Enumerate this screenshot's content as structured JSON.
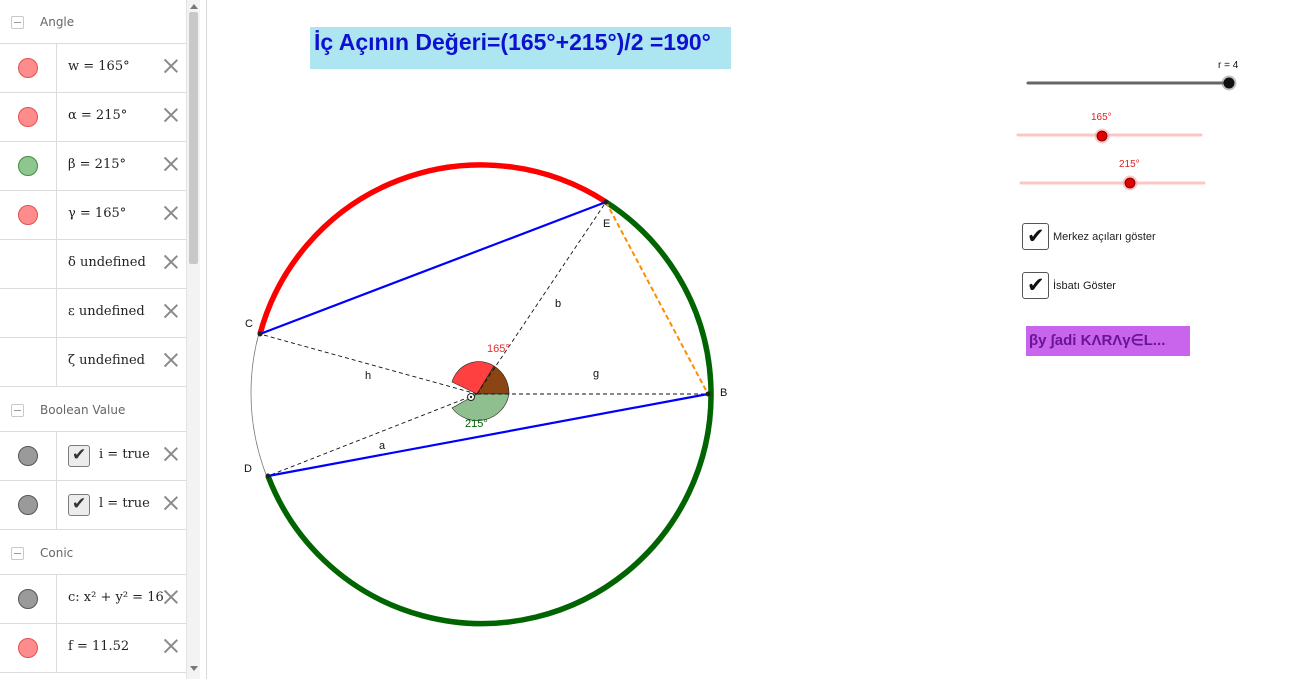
{
  "algebra": {
    "groups": {
      "angle": "Angle",
      "boolean": "Boolean Value",
      "conic": "Conic"
    },
    "angle_rows": [
      {
        "expr": "w = 165°",
        "marble_color": "#ff8080",
        "has_marble": true
      },
      {
        "expr": "α = 215°",
        "marble_color": "#ff8080",
        "has_marble": true
      },
      {
        "expr": "β = 215°",
        "marble_color": "#8fc58f",
        "has_marble": true
      },
      {
        "expr": "γ = 165°",
        "marble_color": "#ff8080",
        "has_marble": true
      },
      {
        "expr": "δ undefined",
        "has_marble": false
      },
      {
        "expr": "ε undefined",
        "has_marble": false
      },
      {
        "expr": "ζ undefined",
        "has_marble": false
      }
    ],
    "boolean_rows": [
      {
        "expr": "i = true",
        "checked": true,
        "marble_color": "#9a9a9a"
      },
      {
        "expr": "l = true",
        "checked": true,
        "marble_color": "#9a9a9a"
      }
    ],
    "conic_rows": [
      {
        "expr": "c: x² + y² = 16",
        "marble_color": "#9a9a9a"
      },
      {
        "expr": "f = 11.52",
        "marble_color": "#ff8080"
      }
    ]
  },
  "graphics": {
    "title": "İç Açının Değeri=(165°+215°)/2 =190°",
    "slider_r": {
      "label": "r = 4",
      "value": 4
    },
    "slider_angle1": {
      "label": "165°",
      "value": 165
    },
    "slider_angle2": {
      "label": "215°",
      "value": 215
    },
    "checkbox_center": {
      "label": "Merkez açıları göster",
      "checked": true
    },
    "checkbox_proof": {
      "label": "İsbatı Göster",
      "checked": true
    },
    "author": "βy ∫adi    KΛRΛγ∈L...",
    "points": {
      "C": "C",
      "D": "D",
      "E": "E",
      "B": "B"
    },
    "segments": {
      "h": "h",
      "b": "b",
      "g": "g",
      "a": "a"
    },
    "angle_labels": {
      "red": "165°",
      "green": "215°"
    },
    "colors": {
      "red_arc": "#ff0000",
      "green_arc": "#006400",
      "chord": "#0000ff",
      "orange": "#ff8c00",
      "red_sector": "#ff4040",
      "green_sector": "#8fbf8f",
      "brown_sector": "#8b4513",
      "title_bg": "#ade6f0",
      "title_text": "#1010d0",
      "author_bg": "#c964ec"
    }
  }
}
